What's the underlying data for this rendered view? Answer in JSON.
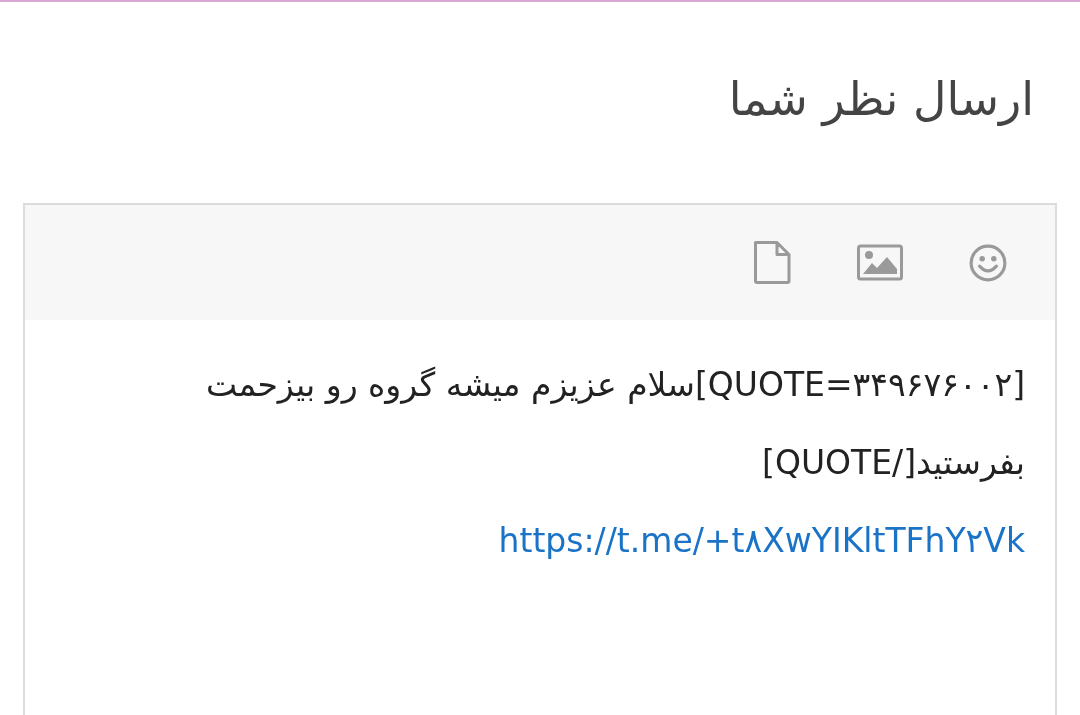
{
  "title": "ارسال نظر شما",
  "toolbar": [
    {
      "kind": "emoji"
    },
    {
      "kind": "image"
    },
    {
      "kind": "file"
    }
  ],
  "editor": {
    "message": "[QUOTE=۳۴۹۶۷۶۰۰۲]سلام عزیزم میشه گروه رو بیزحمت بفرستید[/QUOTE]",
    "link": "https://t.me/+t۸XwYIKltTFhY۲Vk"
  }
}
